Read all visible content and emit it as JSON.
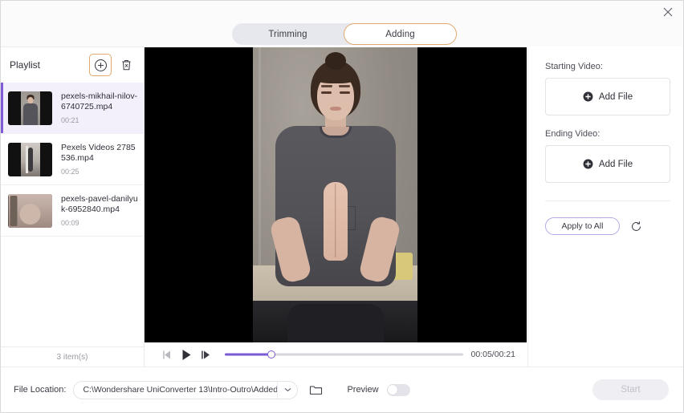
{
  "window": {
    "close_icon": "close-icon"
  },
  "tabs": {
    "items": [
      {
        "label": "Trimming",
        "active": false
      },
      {
        "label": "Adding",
        "active": true
      }
    ],
    "active_border_color": "#e0a96d"
  },
  "playlist": {
    "title": "Playlist",
    "add_icon": "circle-plus-icon",
    "delete_icon": "trash-icon",
    "add_button_highlight_color": "#e0a96d",
    "selected_accent_color": "#7f5bd6",
    "items": [
      {
        "name": "pexels-mikhail-nilov-6740725.mp4",
        "duration": "00:21",
        "selected": true
      },
      {
        "name": "Pexels Videos 2785536.mp4",
        "duration": "00:25",
        "selected": false
      },
      {
        "name": "pexels-pavel-danilyuk-6952840.mp4",
        "duration": "00:09",
        "selected": false
      }
    ],
    "count_label": "3 item(s)"
  },
  "player": {
    "prev_frame_icon": "step-backward-icon",
    "play_icon": "play-icon",
    "next_frame_icon": "step-forward-icon",
    "progress_percent": 19.5,
    "time": "00:05/00:21",
    "accent_color": "#7b5ad6"
  },
  "right_panel": {
    "starting_video_label": "Starting Video:",
    "starting_add_label": "Add File",
    "ending_video_label": "Ending Video:",
    "ending_add_label": "Add File",
    "add_icon": "plus-circle-filled-icon",
    "apply_to_all_label": "Apply to All",
    "reset_icon": "reset-icon",
    "apply_border_color": "#b9a8e4"
  },
  "bottom_bar": {
    "file_location_label": "File Location:",
    "file_location_value": "C:\\Wondershare UniConverter 13\\Intro-Outro\\Added",
    "dropdown_icon": "chevron-down-icon",
    "folder_icon": "folder-icon",
    "preview_label": "Preview",
    "preview_enabled": false,
    "start_label": "Start",
    "start_enabled": false
  }
}
